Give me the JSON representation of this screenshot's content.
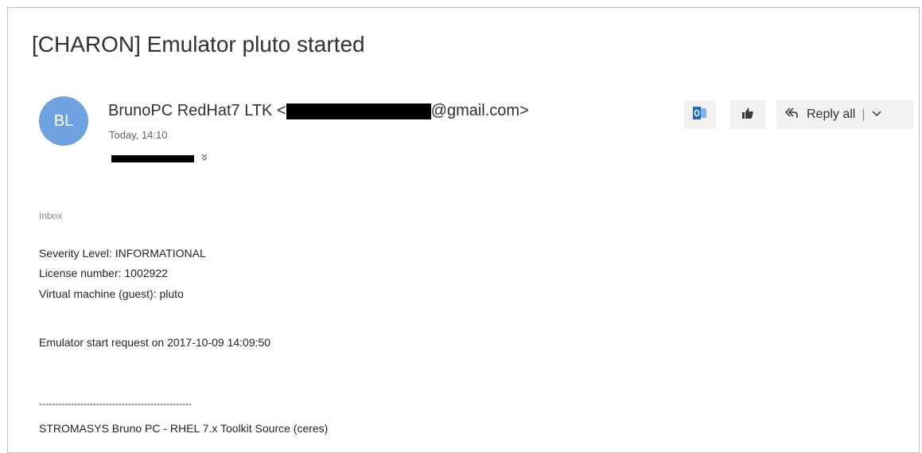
{
  "email": {
    "subject": "[CHARON] Emulator pluto started",
    "avatar_initials": "BL",
    "sender_prefix": "BrunoPC RedHat7 LTK <",
    "sender_suffix": "@gmail.com>",
    "time": "Today, 14:10",
    "folder": "Inbox"
  },
  "actions": {
    "outlook_icon": "outlook-icon",
    "like_icon": "thumbs-up-icon",
    "reply_all_label": "Reply all",
    "separator": "|"
  },
  "body": {
    "severity": "Severity Level: INFORMATIONAL",
    "license": "License number: 1002922",
    "vm": "Virtual machine (guest): pluto",
    "start_request": "Emulator start request on 2017-10-09 14:09:50",
    "divider": "------------------------------------------------",
    "footer": "STROMASYS Bruno PC - RHEL 7.x Toolkit Source (ceres)"
  },
  "colors": {
    "avatar_bg": "#6ea2e0",
    "button_bg": "#f3f2f1",
    "outlook_blue": "#1b6ac9"
  }
}
